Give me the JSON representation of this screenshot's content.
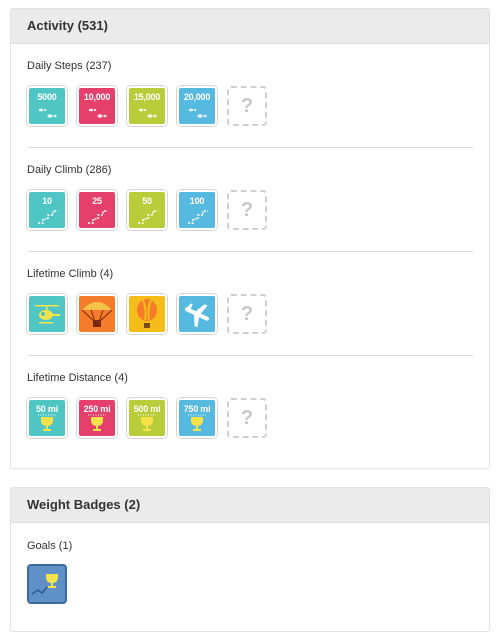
{
  "activity": {
    "title": "Activity (531)",
    "sections": [
      {
        "title": "Daily Steps (237)",
        "badges": [
          {
            "label": "5000",
            "color": "#4fc6c3",
            "icon": "footprints-icon"
          },
          {
            "label": "10,000",
            "color": "#e4406b",
            "icon": "footprints-icon"
          },
          {
            "label": "15,000",
            "color": "#b9cc3a",
            "icon": "footprints-icon"
          },
          {
            "label": "20,000",
            "color": "#56b9e0",
            "icon": "footprints-icon"
          },
          {
            "label": "?",
            "icon": "locked-badge-icon"
          }
        ]
      },
      {
        "title": "Daily Climb (286)",
        "badges": [
          {
            "label": "10",
            "color": "#4fc6c3",
            "icon": "stairs-icon"
          },
          {
            "label": "25",
            "color": "#e4406b",
            "icon": "stairs-icon"
          },
          {
            "label": "50",
            "color": "#b9cc3a",
            "icon": "stairs-icon"
          },
          {
            "label": "100",
            "color": "#56b9e0",
            "icon": "stairs-icon"
          },
          {
            "label": "?",
            "icon": "locked-badge-icon"
          }
        ]
      },
      {
        "title": "Lifetime Climb (4)",
        "badges": [
          {
            "icon": "helicopter-icon",
            "color": "#4fc6c3"
          },
          {
            "icon": "skydiver-icon",
            "color": "#f47c2a"
          },
          {
            "icon": "hot-air-balloon-icon",
            "color": "#f4bd1a"
          },
          {
            "icon": "airplane-icon",
            "color": "#56b9e0"
          },
          {
            "label": "?",
            "icon": "locked-badge-icon"
          }
        ]
      },
      {
        "title": "Lifetime Distance (4)",
        "badges": [
          {
            "label": "50 mi",
            "color": "#4fc6c3",
            "icon": "trophy-icon"
          },
          {
            "label": "250 mi",
            "color": "#e4406b",
            "icon": "trophy-icon"
          },
          {
            "label": "500 mi",
            "color": "#b9cc3a",
            "icon": "trophy-icon"
          },
          {
            "label": "750 mi",
            "color": "#56b9e0",
            "icon": "trophy-icon"
          },
          {
            "label": "?",
            "icon": "locked-badge-icon"
          }
        ]
      }
    ]
  },
  "weight": {
    "title": "Weight Badges (2)",
    "goals_title": "Goals (1)",
    "goal_badge": {
      "icon": "trophy-trend-icon",
      "color": "#5f90c6"
    }
  }
}
